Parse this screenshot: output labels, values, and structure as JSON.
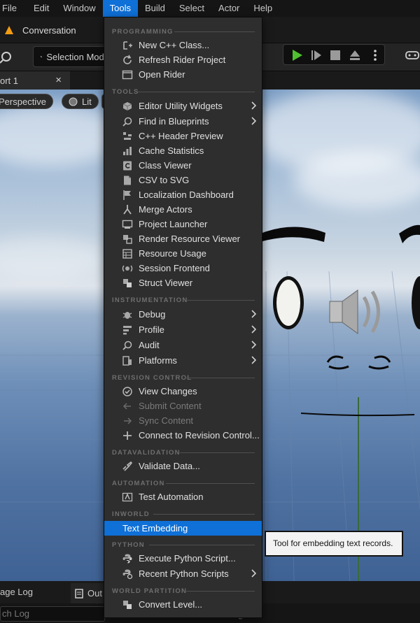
{
  "menubar": {
    "items": [
      "File",
      "Edit",
      "Window",
      "Tools",
      "Build",
      "Select",
      "Actor",
      "Help"
    ],
    "active": "Tools"
  },
  "asset_tab": {
    "label": "Conversation"
  },
  "toolbar": {
    "selection_mode": "Selection Mode"
  },
  "viewport_tab": {
    "label": "ort 1"
  },
  "viewport_chips": {
    "perspective": "Perspective",
    "lit": "Lit"
  },
  "bottom": {
    "log_tab": "age Log",
    "outliner_tab": "Out",
    "search_placeholder": "ch Log",
    "trailing": "g     s"
  },
  "menu": {
    "programming_header": "PROGRAMMING",
    "new_cpp_class": "New C++ Class...",
    "refresh_rider": "Refresh Rider Project",
    "open_rider": "Open Rider",
    "tools_header": "TOOLS",
    "editor_utility_widgets": "Editor Utility Widgets",
    "find_in_blueprints": "Find in Blueprints",
    "cpp_header_preview": "C++ Header Preview",
    "cache_statistics": "Cache Statistics",
    "class_viewer": "Class Viewer",
    "csv_to_svg": "CSV to SVG",
    "localization_dashboard": "Localization Dashboard",
    "merge_actors": "Merge Actors",
    "project_launcher": "Project Launcher",
    "render_resource_viewer": "Render Resource Viewer",
    "resource_usage": "Resource Usage",
    "session_frontend": "Session Frontend",
    "struct_viewer": "Struct Viewer",
    "instrumentation_header": "INSTRUMENTATION",
    "debug": "Debug",
    "profile": "Profile",
    "audit": "Audit",
    "platforms": "Platforms",
    "revision_control_header": "REVISION CONTROL",
    "view_changes": "View Changes",
    "submit_content": "Submit Content",
    "sync_content": "Sync Content",
    "connect_revision_control": "Connect to Revision Control...",
    "datavalidation_header": "DATAVALIDATION",
    "validate_data": "Validate Data...",
    "automation_header": "AUTOMATION",
    "test_automation": "Test Automation",
    "inworld_header": "INWORLD",
    "text_embedding": "Text Embedding",
    "python_header": "PYTHON",
    "execute_python_script": "Execute Python Script...",
    "recent_python_scripts": "Recent Python Scripts",
    "world_partition_header": "WORLD PARTITION",
    "convert_level": "Convert Level..."
  },
  "tooltip": {
    "text": "Tool for embedding text records."
  },
  "colors": {
    "accent": "#0f70d7",
    "menu_bg": "#2e2e2e",
    "header_text": "#6e6e6e"
  }
}
